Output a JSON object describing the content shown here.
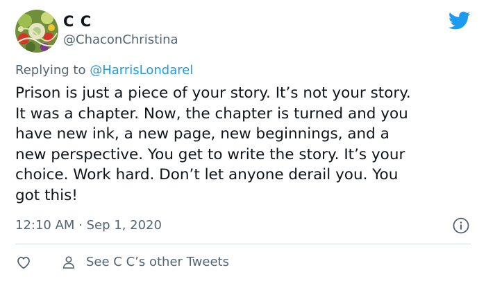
{
  "author": {
    "display_name": "C C",
    "handle": "@ChaconChristina",
    "avatar_icon": "salad-avatar"
  },
  "brand": {
    "icon": "twitter-bird-icon",
    "color": "#1d9bf0"
  },
  "reply": {
    "prefix": "Replying to ",
    "mention": "@HarrisLondarel"
  },
  "tweet": {
    "lines": [
      "Prison is just a piece of your story. It’s not your story.",
      "It was a chapter. Now, the chapter is turned and you",
      "have new ink, a new page, new beginnings, and a",
      "new perspective. You get to write the story. It’s your",
      "choice. Work hard. Don’t let anyone derail you. You",
      "got this!"
    ],
    "timestamp": "12:10 AM · Sep 1, 2020"
  },
  "actions": {
    "like_icon": "heart-icon",
    "info_icon": "info-icon",
    "person_icon": "person-icon",
    "other_tweets_label": "See C C’s other Tweets"
  },
  "colors": {
    "text": "#0f1419",
    "secondary": "#536471",
    "link": "#1d9bf0",
    "divider": "#cfd9de"
  }
}
